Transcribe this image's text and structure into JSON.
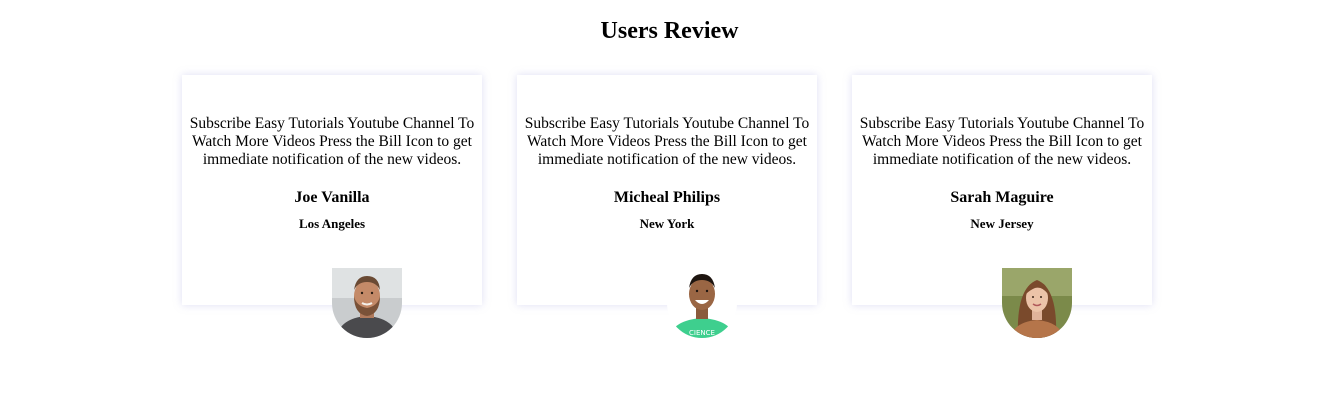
{
  "heading": "Users Review",
  "reviews": [
    {
      "text": "Subscribe Easy Tutorials Youtube Channel To Watch More Videos Press the Bill Icon to get immediate notification of the new videos.",
      "name": "Joe Vanilla",
      "city": "Los Angeles"
    },
    {
      "text": "Subscribe Easy Tutorials Youtube Channel To Watch More Videos Press the Bill Icon to get immediate notification of the new videos.",
      "name": "Micheal Philips",
      "city": "New York"
    },
    {
      "text": "Subscribe Easy Tutorials Youtube Channel To Watch More Videos Press the Bill Icon to get immediate notification of the new videos.",
      "name": "Sarah Maguire",
      "city": "New Jersey"
    }
  ]
}
